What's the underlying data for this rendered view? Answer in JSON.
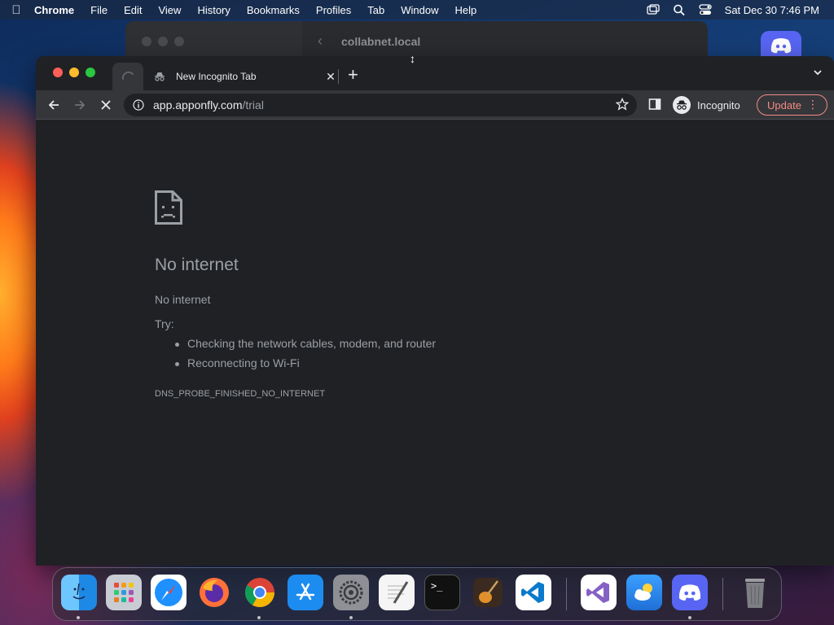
{
  "menubar": {
    "app_name": "Chrome",
    "items": [
      "File",
      "Edit",
      "View",
      "History",
      "Bookmarks",
      "Profiles",
      "Tab",
      "Window",
      "Help"
    ],
    "datetime": "Sat Dec 30  7:46 PM"
  },
  "background_window": {
    "title": "collabnet.local"
  },
  "browser": {
    "tab_title": "New Incognito Tab",
    "url_host": "app.apponfly.com",
    "url_path": "/trial",
    "profile_label": "Incognito",
    "update_label": "Update"
  },
  "error_page": {
    "title": "No internet",
    "subtitle": "No internet",
    "try_label": "Try:",
    "suggestions": [
      "Checking the network cables, modem, and router",
      "Reconnecting to Wi-Fi"
    ],
    "error_code": "DNS_PROBE_FINISHED_NO_INTERNET"
  },
  "dock": {
    "apps": [
      "finder",
      "launchpad",
      "safari",
      "firefox",
      "chrome",
      "app-store",
      "system-settings",
      "textedit",
      "terminal",
      "garageband",
      "vscode",
      "visual-studio",
      "weather",
      "discord",
      "trash"
    ]
  },
  "colors": {
    "chrome_bg": "#202124",
    "toolbar_bg": "#35363a",
    "text_muted": "#9aa0a6",
    "update_accent": "#f28b82"
  }
}
